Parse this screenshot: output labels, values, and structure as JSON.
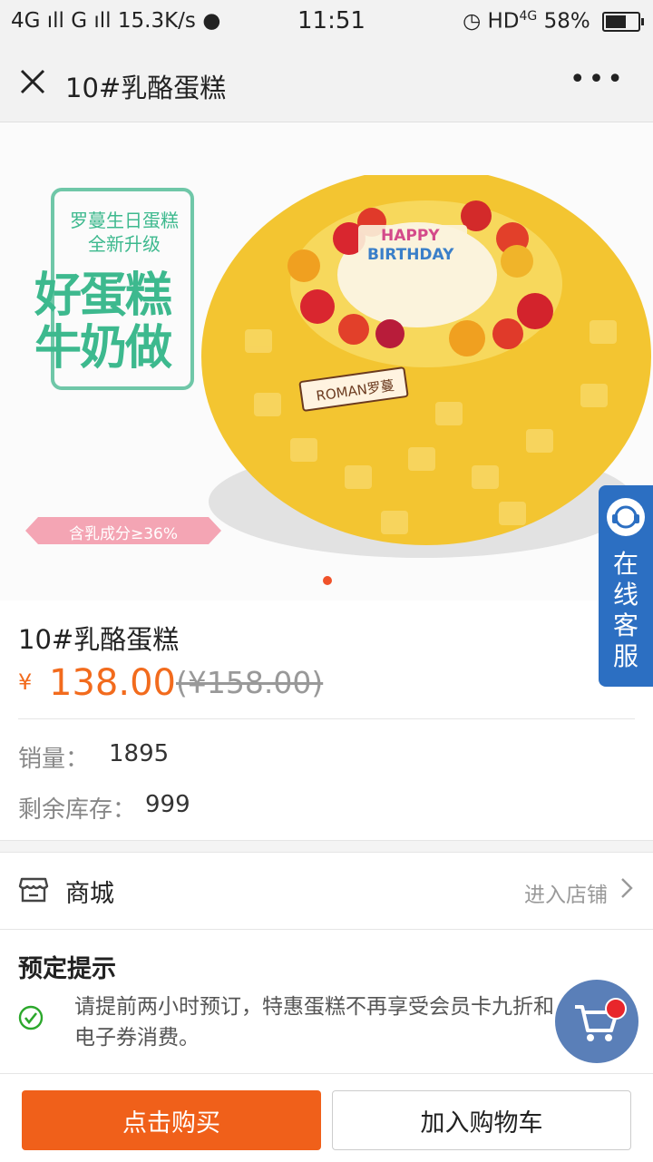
{
  "status_bar": {
    "network": "4G",
    "network2": "G",
    "speed": "15.3K/s",
    "time": "11:51",
    "hd": "HD",
    "network_right": "4G",
    "battery": "58%"
  },
  "nav": {
    "close_icon": "close-icon",
    "title": "10#乳酪蛋糕",
    "more_icon": "more-icon"
  },
  "hero": {
    "promo_line1": "罗蔓生日蛋糕",
    "promo_line2": "全新升级",
    "promo_big1": "好蛋糕",
    "promo_big2": "牛奶做",
    "ribbon": "含乳成分≥36%",
    "cake_topper": "HAPPY BIRTHDAY",
    "cake_badge": "ROMAN罗蔓",
    "carousel_active": 1
  },
  "service_tab": {
    "label": "在线客服"
  },
  "product": {
    "title": "10#乳酪蛋糕",
    "currency": "¥",
    "price": "138.00",
    "original_price": "(¥158.00)",
    "sales_label": "销量：",
    "sales_value": "1895",
    "stock_label": "剩余库存：",
    "stock_value": "999"
  },
  "shop": {
    "name": "商城",
    "enter_label": "进入店铺"
  },
  "tips": {
    "title": "预定提示",
    "text": "请提前两小时预订，特惠蛋糕不再享受会员卡九折和电子券消费。"
  },
  "bottom_bar": {
    "buy_label": "点击购买",
    "cart_label": "加入购物车"
  },
  "colors": {
    "accent": "#f26b1d",
    "buy_button": "#f0601a",
    "service_tab": "#2c6fc2",
    "promo_green": "#3db98e"
  }
}
